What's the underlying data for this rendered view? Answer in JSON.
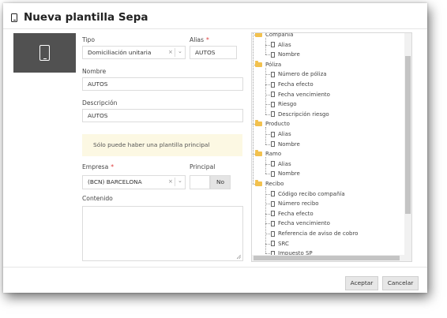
{
  "dialog": {
    "title": "Nueva plantilla Sepa"
  },
  "form": {
    "tipo_label": "Tipo",
    "tipo_value": "Domiciliación unitaria",
    "alias_label": "Alias",
    "alias_value": "AUTOS",
    "nombre_label": "Nombre",
    "nombre_value": "AUTOS",
    "descripcion_label": "Descripción",
    "descripcion_value": "AUTOS",
    "notice": "Sólo puede haber una plantilla principal",
    "empresa_label": "Empresa",
    "empresa_value": "(BCN) BARCELONA",
    "principal_label": "Principal",
    "principal_value": "No",
    "contenido_label": "Contenido",
    "required_mark": "*",
    "clear_glyph": "×",
    "chevron_glyph": "⌄"
  },
  "tree": {
    "items": [
      {
        "label": "Compañía",
        "type": "folder"
      },
      {
        "label": "Alias",
        "type": "file"
      },
      {
        "label": "Nombre",
        "type": "file"
      },
      {
        "label": "Póliza",
        "type": "folder"
      },
      {
        "label": "Número de póliza",
        "type": "file"
      },
      {
        "label": "Fecha efecto",
        "type": "file"
      },
      {
        "label": "Fecha vencimiento",
        "type": "file"
      },
      {
        "label": "Riesgo",
        "type": "file"
      },
      {
        "label": "Descripción riesgo",
        "type": "file"
      },
      {
        "label": "Producto",
        "type": "folder"
      },
      {
        "label": "Alias",
        "type": "file"
      },
      {
        "label": "Nombre",
        "type": "file"
      },
      {
        "label": "Ramo",
        "type": "folder"
      },
      {
        "label": "Alias",
        "type": "file"
      },
      {
        "label": "Nombre",
        "type": "file"
      },
      {
        "label": "Recibo",
        "type": "folder"
      },
      {
        "label": "Código recibo compañía",
        "type": "file"
      },
      {
        "label": "Número recibo",
        "type": "file"
      },
      {
        "label": "Fecha efecto",
        "type": "file"
      },
      {
        "label": "Fecha vencimiento",
        "type": "file"
      },
      {
        "label": "Referencia de aviso de cobro",
        "type": "file"
      },
      {
        "label": "SRC",
        "type": "file"
      },
      {
        "label": "Impuesto SP",
        "type": "file"
      }
    ]
  },
  "buttons": {
    "accept": "Aceptar",
    "cancel": "Cancelar"
  },
  "colors": {
    "notice_bg": "#fcf8e3",
    "folder": "#f2c14e",
    "image_bg": "#515151"
  },
  "icons": {
    "title": "mobile-phone-icon",
    "image": "mobile-phone-icon",
    "folder": "folder-open-icon",
    "file": "file-icon"
  }
}
